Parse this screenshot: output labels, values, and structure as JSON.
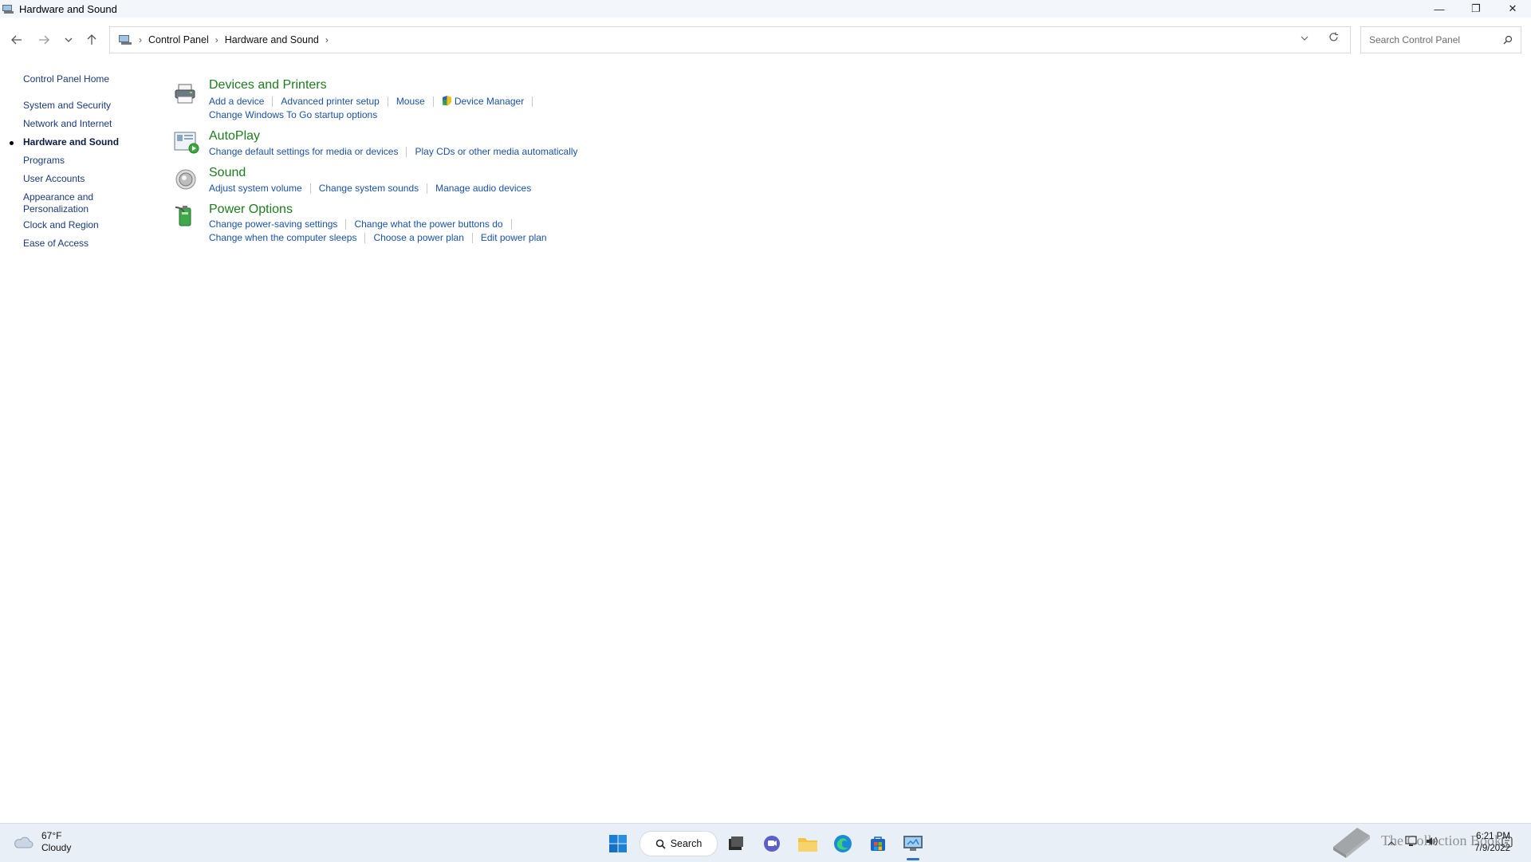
{
  "window": {
    "title": "Hardware and Sound",
    "minimize": "—",
    "restore": "❐",
    "close": "✕"
  },
  "address": {
    "crumbs": [
      "Control Panel",
      "Hardware and Sound"
    ],
    "search_placeholder": "Search Control Panel"
  },
  "leftnav": {
    "items": [
      {
        "label": "Control Panel Home"
      },
      {
        "label": "System and Security"
      },
      {
        "label": "Network and Internet"
      },
      {
        "label": "Hardware and Sound"
      },
      {
        "label": "Programs"
      },
      {
        "label": "User Accounts"
      },
      {
        "label": "Appearance and"
      },
      {
        "label": "Personalization"
      },
      {
        "label": "Clock and Region"
      },
      {
        "label": "Ease of Access"
      }
    ]
  },
  "sections": [
    {
      "title": "Devices and Printers",
      "links_row1": [
        "Add a device",
        "Advanced printer setup",
        "Mouse",
        "Device Manager"
      ],
      "links_row2": [
        "Change Windows To Go startup options"
      ]
    },
    {
      "title": "AutoPlay",
      "links_row1": [
        "Change default settings for media or devices",
        "Play CDs or other media automatically"
      ]
    },
    {
      "title": "Sound",
      "links_row1": [
        "Adjust system volume",
        "Change system sounds",
        "Manage audio devices"
      ]
    },
    {
      "title": "Power Options",
      "links_row1": [
        "Change power-saving settings",
        "Change what the power buttons do"
      ],
      "links_row2": [
        "Change when the computer sleeps",
        "Choose a power plan",
        "Edit power plan"
      ]
    }
  ],
  "taskbar": {
    "weather_temp": "67°F",
    "weather_desc": "Cloudy",
    "search_label": "Search",
    "time": "6:21 PM",
    "date": "7/9/2022",
    "watermark": "The Collection Book"
  },
  "colors": {
    "link": "#1a52a6",
    "section_title": "#1e7b1e",
    "taskbar_bg": "#e9eff6"
  }
}
